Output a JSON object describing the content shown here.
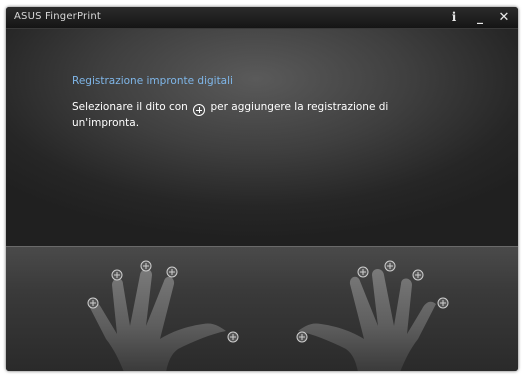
{
  "window": {
    "title": "ASUS FingerPrint",
    "info_label": "i",
    "minimize_label": "_",
    "close_label": "✕"
  },
  "content": {
    "heading": "Registrazione impronte digitali",
    "instruction_before": "Selezionare il dito con",
    "instruction_after": "per aggiungere la registrazione di un'impronta."
  },
  "hands": {
    "left": [
      "left-little",
      "left-ring",
      "left-middle",
      "left-index",
      "left-thumb"
    ],
    "right": [
      "right-thumb",
      "right-index",
      "right-middle",
      "right-ring",
      "right-little"
    ]
  },
  "colors": {
    "heading": "#7fb6e8",
    "hand_fill": "#6e6e6e",
    "plus_icon": "#cfcfcf"
  }
}
